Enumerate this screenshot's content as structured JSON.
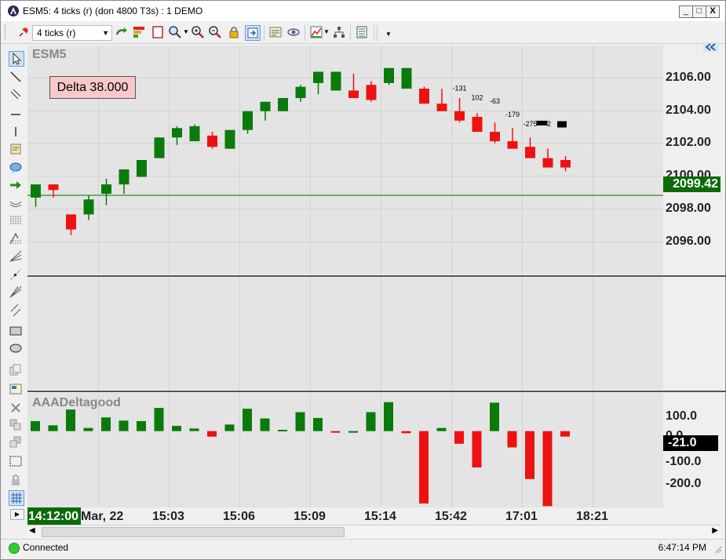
{
  "window": {
    "title": "ESM5: 4 ticks (r) (don 4800  T3s) : 1 DEMO",
    "minimize_label": "_",
    "maximize_label": "□",
    "close_label": "X"
  },
  "toolbar": {
    "period_value": "4 ticks (r)",
    "icons": [
      "pin-icon",
      "redo-arrow-icon",
      "color-bars-icon",
      "page-icon",
      "zoom-menu-icon",
      "zoom-in-icon",
      "zoom-out-icon",
      "lock-icon",
      "fit-icon",
      "properties-icon",
      "eye-icon",
      "indicator-icon",
      "hierarchy-icon",
      "list-icon",
      "dropdown-more-icon"
    ]
  },
  "colors": {
    "up": "#0a7a0a",
    "down": "#ee1111",
    "price_line": "#0b6b0b",
    "chart_bg": "#e4e4e4",
    "delta_box_bg": "#f9c8c8",
    "last_price_bg": "#0b6b0b",
    "indicator_value_bg": "#000000"
  },
  "price_pane": {
    "title": "ESM5",
    "delta_label": "Delta 38.000",
    "last_price": "2099.42"
  },
  "indicator_pane": {
    "title": "AAADeltagood",
    "current_value": "-21.0"
  },
  "time_axis": {
    "highlight": "14:12:00",
    "labels": [
      "Mar, 22",
      "15:03",
      "15:06",
      "15:09",
      "15:14",
      "15:42",
      "17:01",
      "18:21"
    ]
  },
  "status": {
    "connection": "Connected",
    "clock": "6:47:14 PM"
  },
  "chart_data": [
    {
      "type": "candlestick",
      "title": "ESM5",
      "y_axis_labels": [
        "2106.00",
        "2104.00",
        "2102.00",
        "2100.00",
        "2098.00",
        "2096.00"
      ],
      "ylim": [
        2095.2,
        2107.4
      ],
      "candles": [
        {
          "o": 2099.3,
          "h": 2099.6,
          "l": 2098.8,
          "c": 2100.0
        },
        {
          "o": 2100.0,
          "h": 2100.0,
          "l": 2099.3,
          "c": 2099.7
        },
        {
          "o": 2098.4,
          "h": 2098.4,
          "l": 2097.3,
          "c": 2097.6
        },
        {
          "o": 2098.4,
          "h": 2099.4,
          "l": 2098.1,
          "c": 2099.2
        },
        {
          "o": 2099.5,
          "h": 2100.3,
          "l": 2098.9,
          "c": 2100.0
        },
        {
          "o": 2100.0,
          "h": 2100.8,
          "l": 2099.5,
          "c": 2100.8
        },
        {
          "o": 2100.4,
          "h": 2101.3,
          "l": 2100.4,
          "c": 2101.3
        },
        {
          "o": 2101.4,
          "h": 2102.5,
          "l": 2101.4,
          "c": 2102.5
        },
        {
          "o": 2102.5,
          "h": 2103.1,
          "l": 2102.1,
          "c": 2103.0
        },
        {
          "o": 2102.3,
          "h": 2103.2,
          "l": 2102.3,
          "c": 2103.1
        },
        {
          "o": 2102.6,
          "h": 2102.8,
          "l": 2101.9,
          "c": 2102.0
        },
        {
          "o": 2101.9,
          "h": 2102.9,
          "l": 2101.9,
          "c": 2102.9
        },
        {
          "o": 2102.9,
          "h": 2103.9,
          "l": 2102.7,
          "c": 2103.9
        },
        {
          "o": 2103.9,
          "h": 2104.4,
          "l": 2103.4,
          "c": 2104.4
        },
        {
          "o": 2103.9,
          "h": 2104.6,
          "l": 2103.9,
          "c": 2104.6
        },
        {
          "o": 2104.6,
          "h": 2105.3,
          "l": 2104.4,
          "c": 2105.2
        },
        {
          "o": 2105.4,
          "h": 2106.0,
          "l": 2104.8,
          "c": 2106.0
        },
        {
          "o": 2105.0,
          "h": 2106.0,
          "l": 2105.0,
          "c": 2106.0
        },
        {
          "o": 2105.0,
          "h": 2105.9,
          "l": 2104.6,
          "c": 2104.6
        },
        {
          "o": 2105.3,
          "h": 2105.5,
          "l": 2104.4,
          "c": 2104.5
        },
        {
          "o": 2105.4,
          "h": 2106.2,
          "l": 2105.3,
          "c": 2106.2
        },
        {
          "o": 2105.1,
          "h": 2106.2,
          "l": 2105.1,
          "c": 2106.2
        },
        {
          "o": 2105.1,
          "h": 2105.2,
          "l": 2104.3,
          "c": 2104.3
        },
        {
          "o": 2104.3,
          "h": 2105.1,
          "l": 2104.0,
          "c": 2103.9
        },
        {
          "o": 2103.9,
          "h": 2104.6,
          "l": 2103.3,
          "c": 2103.4
        },
        {
          "o": 2103.6,
          "h": 2103.8,
          "l": 2102.8,
          "c": 2102.8
        },
        {
          "o": 2102.8,
          "h": 2103.3,
          "l": 2102.2,
          "c": 2102.3
        },
        {
          "o": 2102.3,
          "h": 2103.0,
          "l": 2101.9,
          "c": 2101.9
        },
        {
          "o": 2102.0,
          "h": 2102.5,
          "l": 2101.4,
          "c": 2101.4
        },
        {
          "o": 2101.4,
          "h": 2101.9,
          "l": 2100.9,
          "c": 2100.9
        },
        {
          "o": 2101.3,
          "h": 2101.5,
          "l": 2100.7,
          "c": 2100.9
        }
      ],
      "annotations": [
        {
          "text": "-131",
          "x": 24,
          "y": 2105.0
        },
        {
          "text": "102",
          "x": 25,
          "y": 2104.5
        },
        {
          "text": "-63",
          "x": 26,
          "y": 2104.3
        },
        {
          "text": "-179",
          "x": 27,
          "y": 2103.6
        },
        {
          "text": "-275",
          "x": 28,
          "y": 2103.1
        },
        {
          "text": "-2",
          "x": 29,
          "y": 2103.1
        }
      ],
      "hline": 2099.42
    },
    {
      "type": "bar",
      "title": "AAADeltagood",
      "y_axis_labels": [
        "100.0",
        "0.0",
        "-100.0",
        "-200.0"
      ],
      "ylim": [
        -290,
        145
      ],
      "values": [
        38,
        22,
        82,
        12,
        52,
        40,
        38,
        88,
        20,
        10,
        -21,
        25,
        85,
        48,
        5,
        72,
        50,
        -4,
        0,
        72,
        110,
        -8,
        -275,
        12,
        -48,
        -138,
        108,
        -62,
        -182,
        -285,
        -21
      ]
    }
  ]
}
